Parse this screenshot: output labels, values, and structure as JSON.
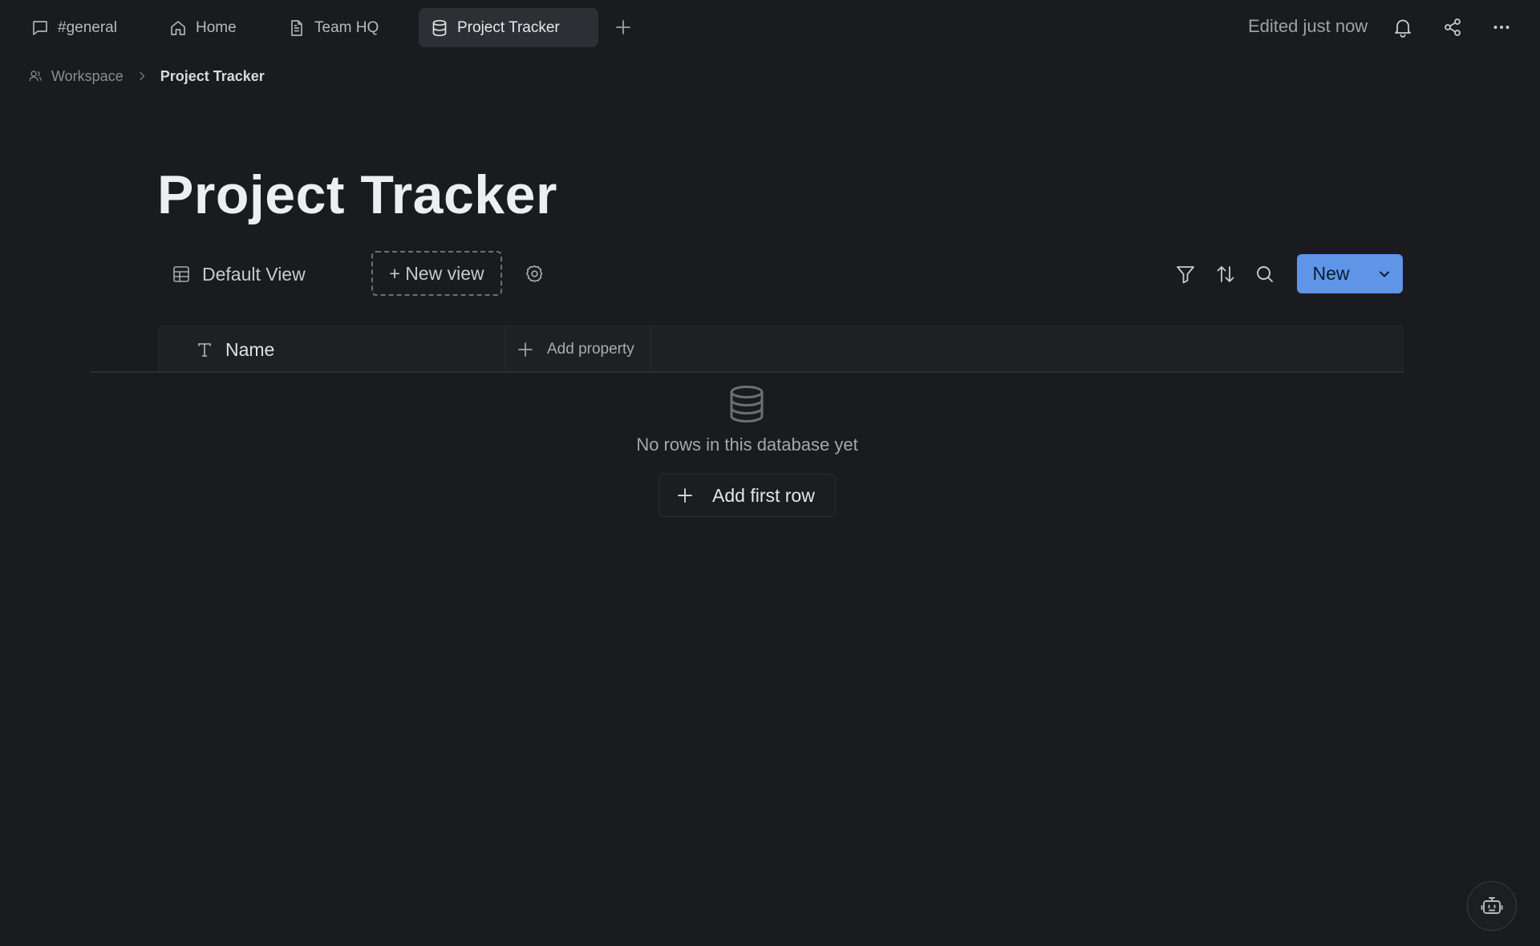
{
  "tabs": [
    {
      "label": "#general",
      "icon": "message-square-icon"
    },
    {
      "label": "Home",
      "icon": "home-icon"
    },
    {
      "label": "Team HQ",
      "icon": "document-icon"
    },
    {
      "label": "Project Tracker",
      "icon": "database-icon",
      "active": true
    }
  ],
  "header": {
    "edited_status": "Edited just now"
  },
  "breadcrumb": {
    "workspace": "Workspace",
    "current": "Project Tracker"
  },
  "page": {
    "title": "Project Tracker"
  },
  "views": {
    "default_view": "Default View",
    "new_view": "+ New view"
  },
  "toolbar": {
    "new_label": "New"
  },
  "table": {
    "columns": [
      {
        "label": "Name",
        "icon": "text-type-icon"
      }
    ],
    "add_property": "Add property"
  },
  "empty_state": {
    "message": "No rows in this database yet",
    "add_first_row": "Add first row"
  },
  "colors": {
    "background": "#191b1e",
    "accent": "#5e95e6"
  }
}
